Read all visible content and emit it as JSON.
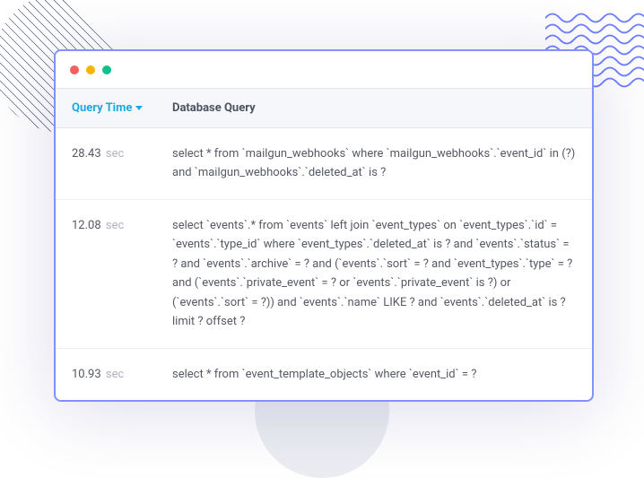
{
  "headers": {
    "query_time": "Query Time",
    "database_query": "Database Query"
  },
  "rows": [
    {
      "time_value": "28.43",
      "time_unit": "sec",
      "query": "select * from `mailgun_webhooks` where `mailgun_webhooks`.`event_id` in (?) and `mailgun_webhooks`.`deleted_at` is ?"
    },
    {
      "time_value": "12.08",
      "time_unit": "sec",
      "query": "select `events`.* from `events` left join `event_types` on `event_types`.`id` = `events`.`type_id` where `event_types`.`deleted_at` is ? and `events`.`status` = ? and `events`.`archive` = ? and (`events`.`sort` = ? and `event_types`.`type` = ? and (`events`.`private_event` = ? or `events`.`private_event` is ?) or (`events`.`sort` = ?)) and `events`.`name` LIKE ? and `events`.`deleted_at` is ? limit ? offset ?"
    },
    {
      "time_value": "10.93",
      "time_unit": "sec",
      "query": "select * from `event_template_objects` where `event_id` = ?"
    }
  ]
}
